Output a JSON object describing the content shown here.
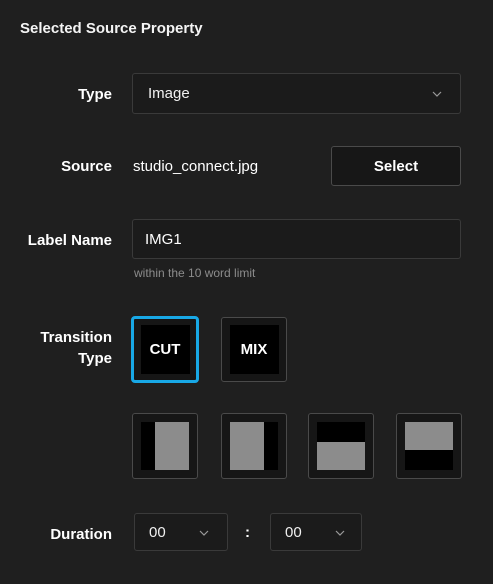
{
  "panel": {
    "title": "Selected Source Property"
  },
  "type": {
    "label": "Type",
    "value": "Image"
  },
  "source": {
    "label": "Source",
    "filename": "studio_connect.jpg",
    "select_label": "Select"
  },
  "label_name": {
    "label": "Label Name",
    "value": "IMG1",
    "hint": "within the 10 word limit"
  },
  "transition": {
    "label_line1": "Transition",
    "label_line2": "Type",
    "cut_label": "CUT",
    "mix_label": "MIX",
    "selected": "CUT",
    "accent_color": "#18a8e6"
  },
  "duration": {
    "label": "Duration",
    "minutes": "00",
    "separator": ":",
    "seconds": "00"
  }
}
